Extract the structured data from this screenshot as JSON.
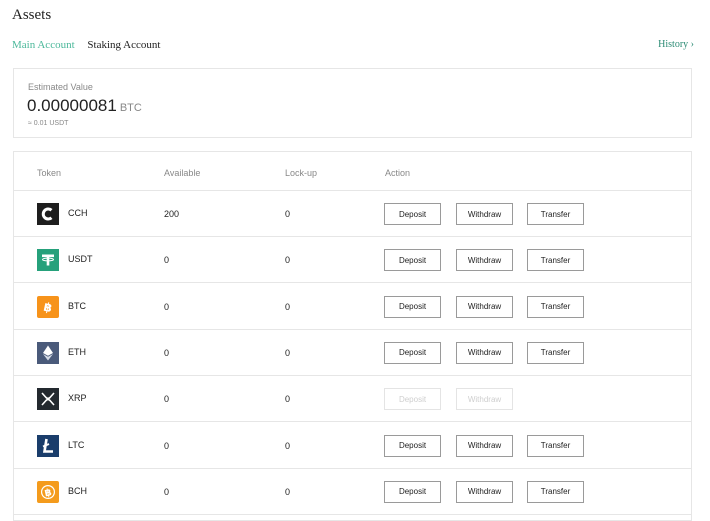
{
  "page": {
    "title": "Assets"
  },
  "tabs": [
    {
      "label": "Main Account",
      "active": true
    },
    {
      "label": "Staking Account",
      "active": false
    }
  ],
  "history_link": "History ›",
  "estimate": {
    "label": "Estimated Value",
    "value": "0.00000081",
    "unit": "BTC",
    "sub": "≈ 0.01 USDT"
  },
  "table": {
    "headers": {
      "token": "Token",
      "available": "Available",
      "lockup": "Lock-up",
      "action": "Action"
    },
    "actions": {
      "deposit": "Deposit",
      "withdraw": "Withdraw",
      "transfer": "Transfer"
    },
    "rows": [
      {
        "symbol": "CCH",
        "available": "200",
        "lockup": "0",
        "icon": "cch-icon",
        "color": "#1e1e1e",
        "actions_enabled": true,
        "transfer": true
      },
      {
        "symbol": "USDT",
        "available": "0",
        "lockup": "0",
        "icon": "tether-icon",
        "color": "#26a17b",
        "actions_enabled": true,
        "transfer": true
      },
      {
        "symbol": "BTC",
        "available": "0",
        "lockup": "0",
        "icon": "bitcoin-icon",
        "color": "#f7931a",
        "actions_enabled": true,
        "transfer": true
      },
      {
        "symbol": "ETH",
        "available": "0",
        "lockup": "0",
        "icon": "ethereum-icon",
        "color": "#4a5a7a",
        "actions_enabled": true,
        "transfer": true
      },
      {
        "symbol": "XRP",
        "available": "0",
        "lockup": "0",
        "icon": "xrp-icon",
        "color": "#23292f",
        "actions_enabled": false,
        "transfer": false
      },
      {
        "symbol": "LTC",
        "available": "0",
        "lockup": "0",
        "icon": "litecoin-icon",
        "color": "#1a3d6b",
        "actions_enabled": true,
        "transfer": true
      },
      {
        "symbol": "BCH",
        "available": "0",
        "lockup": "0",
        "icon": "bitcoin-cash-icon",
        "color": "#f49b1c",
        "actions_enabled": true,
        "transfer": true
      }
    ]
  }
}
